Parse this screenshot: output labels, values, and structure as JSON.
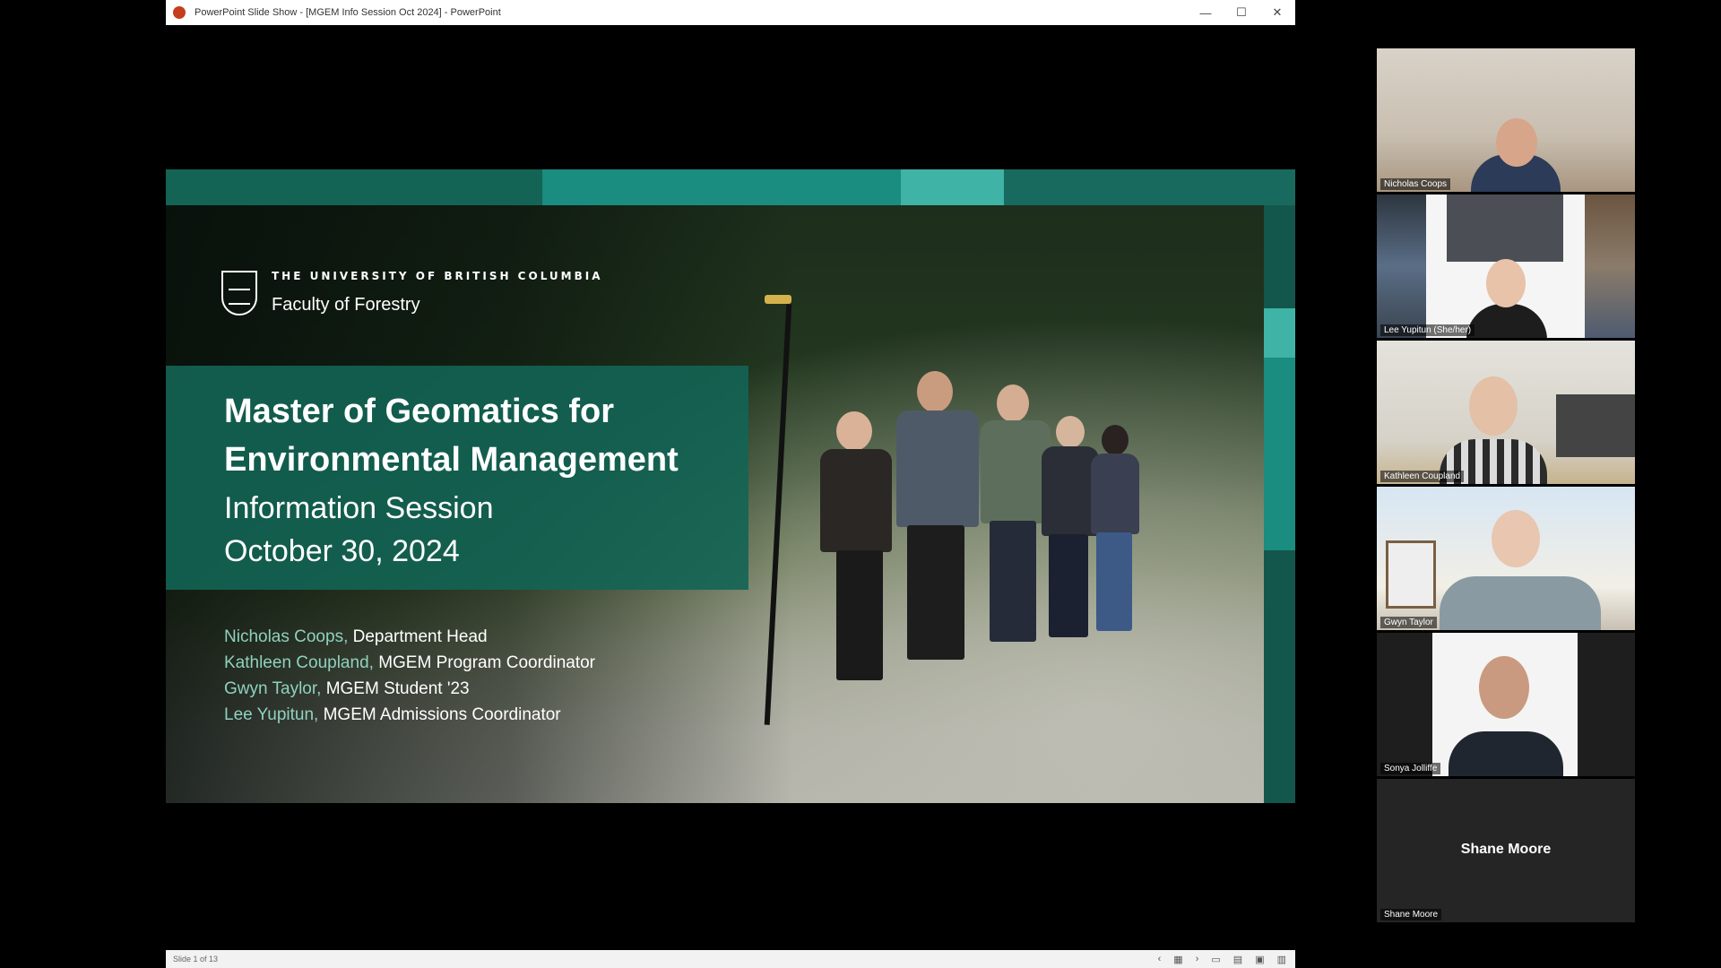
{
  "window": {
    "title": "PowerPoint Slide Show - [MGEM Info Session Oct 2024] - PowerPoint",
    "controls": {
      "minimize": "—",
      "maximize": "☐",
      "close": "✕"
    }
  },
  "status_bar": {
    "slide_position": "Slide 1 of 13",
    "nav_prev": "‹",
    "nav_next": "›"
  },
  "slide": {
    "university": "THE UNIVERSITY OF BRITISH COLUMBIA",
    "university_logo_text": "UBC",
    "faculty": "Faculty of Forestry",
    "title_line1": "Master of Geomatics for",
    "title_line2": "Environmental Management",
    "subtitle": "Information Session",
    "date": "October 30, 2024",
    "presenters": [
      {
        "name": "Nicholas Coops,",
        "role": " Department Head"
      },
      {
        "name": "Kathleen Coupland,",
        "role": " MGEM Program Coordinator"
      },
      {
        "name": "Gwyn Taylor,",
        "role": " MGEM Student '23"
      },
      {
        "name": "Lee Yupitun,",
        "role": " MGEM Admissions Coordinator"
      }
    ],
    "colors": {
      "teal_dark": "#136454",
      "teal_mid": "#1a8c80",
      "teal_light": "#3fb3a5",
      "presenter_name": "#8fd1bf"
    }
  },
  "participants": [
    {
      "name": "Nicholas Coops"
    },
    {
      "name": "Lee Yupitun (She/her)"
    },
    {
      "name": "Kathleen Coupland"
    },
    {
      "name": "Gwyn Taylor"
    },
    {
      "name": "Sonya Jolliffe"
    },
    {
      "name": "Shane Moore",
      "display_label": "Shane Moore"
    }
  ]
}
